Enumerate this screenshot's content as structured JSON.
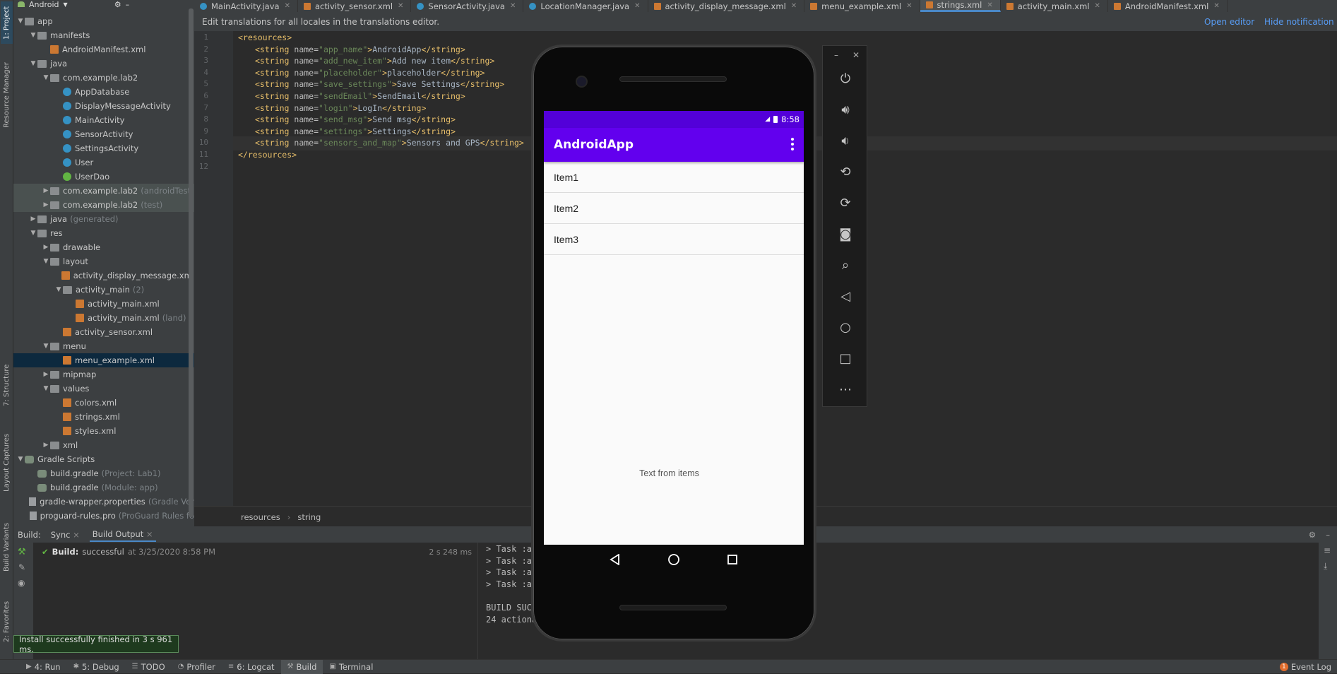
{
  "left_strip": {
    "tabs": [
      "1: Project",
      "Resource Manager",
      "7: Structure",
      "Layout Captures",
      "Build Variants",
      "2: Favorites"
    ]
  },
  "project": {
    "view": "Android",
    "tree": [
      {
        "depth": 0,
        "arrow": "▼",
        "icon": "folder",
        "label": "app",
        "hint": ""
      },
      {
        "depth": 1,
        "arrow": "▼",
        "icon": "folder",
        "label": "manifests",
        "hint": ""
      },
      {
        "depth": 2,
        "arrow": "",
        "icon": "xml",
        "label": "AndroidManifest.xml",
        "hint": ""
      },
      {
        "depth": 1,
        "arrow": "▼",
        "icon": "folder",
        "label": "java",
        "hint": ""
      },
      {
        "depth": 2,
        "arrow": "▼",
        "icon": "pkg",
        "label": "com.example.lab2",
        "hint": ""
      },
      {
        "depth": 3,
        "arrow": "",
        "icon": "cls",
        "label": "AppDatabase",
        "hint": ""
      },
      {
        "depth": 3,
        "arrow": "",
        "icon": "cls",
        "label": "DisplayMessageActivity",
        "hint": ""
      },
      {
        "depth": 3,
        "arrow": "",
        "icon": "cls",
        "label": "MainActivity",
        "hint": ""
      },
      {
        "depth": 3,
        "arrow": "",
        "icon": "cls",
        "label": "SensorActivity",
        "hint": ""
      },
      {
        "depth": 3,
        "arrow": "",
        "icon": "cls",
        "label": "SettingsActivity",
        "hint": ""
      },
      {
        "depth": 3,
        "arrow": "",
        "icon": "cls",
        "label": "User",
        "hint": ""
      },
      {
        "depth": 3,
        "arrow": "",
        "icon": "intf",
        "label": "UserDao",
        "hint": ""
      },
      {
        "depth": 2,
        "arrow": "▶",
        "icon": "pkg",
        "label": "com.example.lab2",
        "hint": "(androidTest)",
        "shade": true
      },
      {
        "depth": 2,
        "arrow": "▶",
        "icon": "pkg",
        "label": "com.example.lab2",
        "hint": "(test)",
        "shade": true
      },
      {
        "depth": 1,
        "arrow": "▶",
        "icon": "folder",
        "label": "java",
        "hint": "(generated)"
      },
      {
        "depth": 1,
        "arrow": "▼",
        "icon": "folder",
        "label": "res",
        "hint": ""
      },
      {
        "depth": 2,
        "arrow": "▶",
        "icon": "folder",
        "label": "drawable",
        "hint": ""
      },
      {
        "depth": 2,
        "arrow": "▼",
        "icon": "folder",
        "label": "layout",
        "hint": ""
      },
      {
        "depth": 3,
        "arrow": "",
        "icon": "xml",
        "label": "activity_display_message.xml",
        "hint": ""
      },
      {
        "depth": 3,
        "arrow": "▼",
        "icon": "folder",
        "label": "activity_main",
        "hint": "(2)"
      },
      {
        "depth": 4,
        "arrow": "",
        "icon": "xml",
        "label": "activity_main.xml",
        "hint": ""
      },
      {
        "depth": 4,
        "arrow": "",
        "icon": "xml",
        "label": "activity_main.xml",
        "hint": "(land)"
      },
      {
        "depth": 3,
        "arrow": "",
        "icon": "xml",
        "label": "activity_sensor.xml",
        "hint": ""
      },
      {
        "depth": 2,
        "arrow": "▼",
        "icon": "folder",
        "label": "menu",
        "hint": ""
      },
      {
        "depth": 3,
        "arrow": "",
        "icon": "xml",
        "label": "menu_example.xml",
        "hint": "",
        "sel": true
      },
      {
        "depth": 2,
        "arrow": "▶",
        "icon": "folder",
        "label": "mipmap",
        "hint": ""
      },
      {
        "depth": 2,
        "arrow": "▼",
        "icon": "folder",
        "label": "values",
        "hint": ""
      },
      {
        "depth": 3,
        "arrow": "",
        "icon": "xml",
        "label": "colors.xml",
        "hint": ""
      },
      {
        "depth": 3,
        "arrow": "",
        "icon": "xml",
        "label": "strings.xml",
        "hint": ""
      },
      {
        "depth": 3,
        "arrow": "",
        "icon": "xml",
        "label": "styles.xml",
        "hint": ""
      },
      {
        "depth": 2,
        "arrow": "▶",
        "icon": "folder",
        "label": "xml",
        "hint": ""
      },
      {
        "depth": 0,
        "arrow": "▼",
        "icon": "gradle",
        "label": "Gradle Scripts",
        "hint": ""
      },
      {
        "depth": 1,
        "arrow": "",
        "icon": "gradle",
        "label": "build.gradle",
        "hint": "(Project: Lab1)"
      },
      {
        "depth": 1,
        "arrow": "",
        "icon": "gradle",
        "label": "build.gradle",
        "hint": "(Module: app)"
      },
      {
        "depth": 1,
        "arrow": "",
        "icon": "file",
        "label": "gradle-wrapper.properties",
        "hint": "(Gradle Ver"
      },
      {
        "depth": 1,
        "arrow": "",
        "icon": "file",
        "label": "proguard-rules.pro",
        "hint": "(ProGuard Rules fo"
      }
    ]
  },
  "tabs": [
    {
      "label": "MainActivity.java",
      "icon": "cls"
    },
    {
      "label": "activity_sensor.xml",
      "icon": "xml"
    },
    {
      "label": "SensorActivity.java",
      "icon": "cls"
    },
    {
      "label": "LocationManager.java",
      "icon": "cls"
    },
    {
      "label": "activity_display_message.xml",
      "icon": "xml"
    },
    {
      "label": "menu_example.xml",
      "icon": "xml"
    },
    {
      "label": "strings.xml",
      "icon": "xml",
      "active": true
    },
    {
      "label": "activity_main.xml",
      "icon": "xml"
    },
    {
      "label": "AndroidManifest.xml",
      "icon": "xml"
    }
  ],
  "notification": {
    "text": "Edit translations for all locales in the translations editor.",
    "open": "Open editor",
    "hide": "Hide notification"
  },
  "code": [
    {
      "n": "1",
      "ind": 0,
      "tag": "<resources>",
      "name": "",
      "val": "",
      "text": "",
      "close": ""
    },
    {
      "n": "2",
      "ind": 1,
      "tag": "<string ",
      "name": "app_name",
      "val": "",
      "text": "AndroidApp",
      "close": "</string>"
    },
    {
      "n": "3",
      "ind": 1,
      "tag": "<string ",
      "name": "add_new_item",
      "val": "",
      "text": "Add new item",
      "close": "</string>"
    },
    {
      "n": "4",
      "ind": 1,
      "tag": "<string ",
      "name": "placeholder",
      "val": "",
      "text": "placeholder",
      "close": "</string>"
    },
    {
      "n": "5",
      "ind": 1,
      "tag": "<string ",
      "name": "save_settings",
      "val": "",
      "text": "Save Settings",
      "close": "</string>"
    },
    {
      "n": "6",
      "ind": 1,
      "tag": "<string ",
      "name": "sendEmail",
      "val": "",
      "text": "SendEmail",
      "close": "</string>"
    },
    {
      "n": "7",
      "ind": 1,
      "tag": "<string ",
      "name": "login",
      "val": "",
      "text": "LogIn",
      "close": "</string>"
    },
    {
      "n": "8",
      "ind": 1,
      "tag": "<string ",
      "name": "send_msg",
      "val": "",
      "text": "Send msg",
      "close": "</string>"
    },
    {
      "n": "9",
      "ind": 1,
      "tag": "<string ",
      "name": "settings",
      "val": "",
      "text": "Settings",
      "close": "</string>"
    },
    {
      "n": "10",
      "ind": 1,
      "tag": "<string ",
      "name": "sensors_and_map",
      "val": "",
      "text": "Sensors and GPS",
      "close": "</string>",
      "current": true
    },
    {
      "n": "11",
      "ind": 0,
      "tag": "</resources>",
      "name": "",
      "val": "",
      "text": "",
      "close": ""
    },
    {
      "n": "12",
      "ind": 0,
      "tag": "",
      "name": "",
      "val": "",
      "text": "",
      "close": ""
    }
  ],
  "breadcrumb": [
    "resources",
    "string"
  ],
  "build": {
    "tabs": {
      "label": "Build:",
      "sync": "Sync",
      "output": "Build Output"
    },
    "result_label": "Build:",
    "result": "successful",
    "result_time": "at 3/25/2020 8:58 PM",
    "duration": "2 s 248 ms",
    "output": [
      "> Task :app:",
      "> Task :app:",
      "> Task :app:",
      "> Task :app:",
      "",
      "BUILD SUCCESS",
      "24 actionable"
    ]
  },
  "toast": "Install successfully finished in 3 s 961 ms.",
  "statusbar": {
    "items": [
      {
        "label": "4: Run",
        "icon": "▶"
      },
      {
        "label": "5: Debug",
        "icon": "✱"
      },
      {
        "label": "TODO",
        "icon": "☰"
      },
      {
        "label": "Profiler",
        "icon": "◔"
      },
      {
        "label": "6: Logcat",
        "icon": "≡"
      },
      {
        "label": "Build",
        "icon": "⚒",
        "active": true
      },
      {
        "label": "Terminal",
        "icon": "▣"
      }
    ],
    "event_log": "Event Log",
    "event_count": "1"
  },
  "phone": {
    "time": "8:58",
    "app_title": "AndroidApp",
    "items": [
      "Item1",
      "Item2",
      "Item3"
    ],
    "center_text": "Text from items",
    "colors": {
      "primary": "#6200ee",
      "primary_dark": "#5300d9"
    }
  },
  "emulator_toolbar": [
    "power-icon",
    "volume-up-icon",
    "volume-down-icon",
    "rotate-left-icon",
    "rotate-right-icon",
    "camera-icon",
    "zoom-icon",
    "back-icon",
    "home-icon",
    "overview-icon",
    "more-icon"
  ]
}
